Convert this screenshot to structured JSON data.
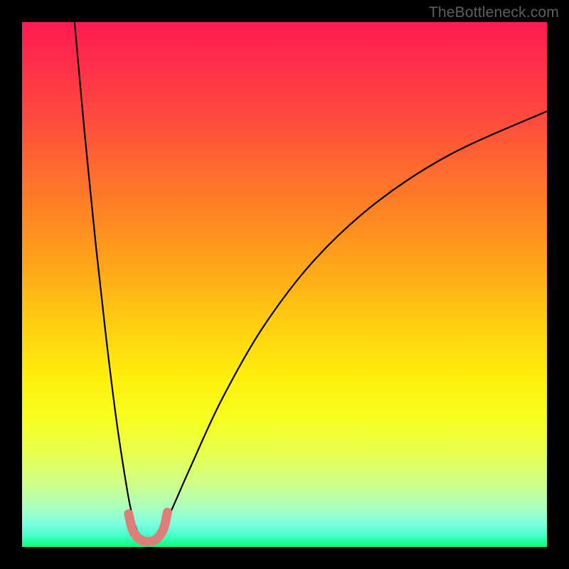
{
  "watermark": "TheBottleneck.com",
  "chart_data": {
    "type": "line",
    "title": "",
    "xlabel": "",
    "ylabel": "",
    "xlim": [
      0,
      100
    ],
    "ylim": [
      0,
      100
    ],
    "notch": {
      "center_x": 24,
      "width": 6,
      "floor_y": 2
    },
    "series": [
      {
        "name": "left-branch",
        "x": [
          10.0,
          12.0,
          14.0,
          16.0,
          18.0,
          20.0,
          21.0,
          22.0,
          23.0,
          24.0
        ],
        "y": [
          100.0,
          78.0,
          58.0,
          40.0,
          24.0,
          11.0,
          6.0,
          3.0,
          1.5,
          1.0
        ]
      },
      {
        "name": "right-branch",
        "x": [
          24.0,
          26.0,
          28.0,
          32.0,
          38.0,
          46.0,
          56.0,
          68.0,
          82.0,
          100.0
        ],
        "y": [
          1.0,
          2.5,
          6.0,
          15.0,
          28.0,
          42.0,
          55.0,
          66.0,
          75.0,
          83.0
        ]
      },
      {
        "name": "notch-marker",
        "x": [
          20.3,
          21.0,
          22.0,
          23.0,
          24.0,
          25.0,
          26.0,
          27.0,
          27.7
        ],
        "y": [
          6.3,
          3.4,
          1.8,
          1.2,
          1.0,
          1.2,
          1.9,
          3.6,
          6.6
        ]
      }
    ]
  }
}
